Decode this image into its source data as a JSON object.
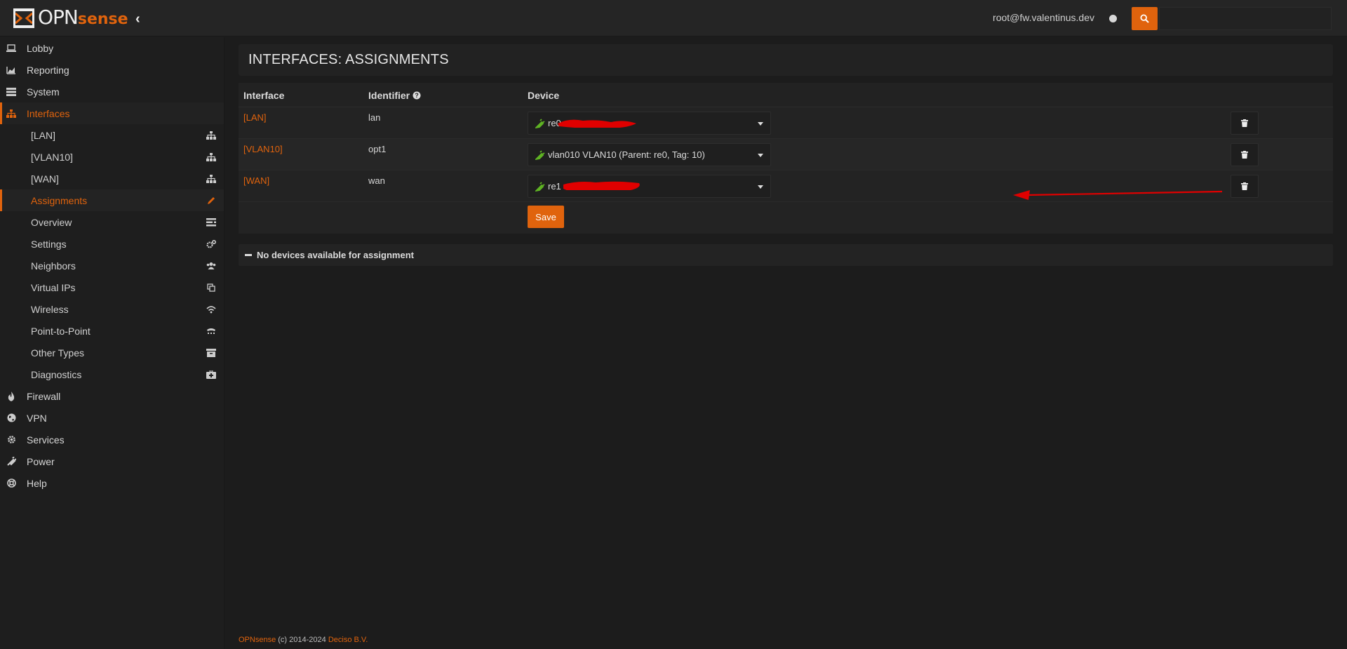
{
  "app": {
    "logo_main": "OPN",
    "logo_sense": "sense",
    "user": "root@fw.valentinus.dev",
    "search_placeholder": ""
  },
  "sidebar": {
    "items": [
      {
        "label": "Lobby",
        "icon": "laptop-icon"
      },
      {
        "label": "Reporting",
        "icon": "area-chart-icon"
      },
      {
        "label": "System",
        "icon": "server-icon"
      },
      {
        "label": "Interfaces",
        "icon": "sitemap-icon"
      }
    ],
    "sub_items": [
      {
        "label": "[LAN]",
        "icon": "sitemap-icon"
      },
      {
        "label": "[VLAN10]",
        "icon": "sitemap-icon"
      },
      {
        "label": "[WAN]",
        "icon": "sitemap-icon"
      },
      {
        "label": "Assignments",
        "icon": "pencil-icon"
      },
      {
        "label": "Overview",
        "icon": "tasks-icon"
      },
      {
        "label": "Settings",
        "icon": "cogs-icon"
      },
      {
        "label": "Neighbors",
        "icon": "users-icon"
      },
      {
        "label": "Virtual IPs",
        "icon": "clone-icon"
      },
      {
        "label": "Wireless",
        "icon": "wifi-icon"
      },
      {
        "label": "Point-to-Point",
        "icon": "tty-icon"
      },
      {
        "label": "Other Types",
        "icon": "archive-icon"
      },
      {
        "label": "Diagnostics",
        "icon": "medkit-icon"
      }
    ],
    "bottom_items": [
      {
        "label": "Firewall",
        "icon": "fire-icon"
      },
      {
        "label": "VPN",
        "icon": "globe-icon"
      },
      {
        "label": "Services",
        "icon": "cog-icon"
      },
      {
        "label": "Power",
        "icon": "plug-icon"
      },
      {
        "label": "Help",
        "icon": "life-ring-icon"
      }
    ]
  },
  "page": {
    "title": "INTERFACES: ASSIGNMENTS"
  },
  "table": {
    "headers": {
      "interface": "Interface",
      "identifier": "Identifier",
      "device": "Device"
    },
    "rows": [
      {
        "interface": "[LAN]",
        "identifier": "lan",
        "device": "re0"
      },
      {
        "interface": "[VLAN10]",
        "identifier": "opt1",
        "device": "vlan010 VLAN10 (Parent: re0, Tag: 10)"
      },
      {
        "interface": "[WAN]",
        "identifier": "wan",
        "device": "re1"
      }
    ],
    "save_label": "Save"
  },
  "no_devices": "No devices available for assignment",
  "footer": {
    "brand": "OPNsense",
    "copy": " (c) 2014-2024 ",
    "company": "Deciso B.V."
  },
  "colors": {
    "accent": "#e0630d",
    "background": "#1c1c1c",
    "annotation_arrow": "#e00000",
    "device_icon": "#5fb323"
  }
}
